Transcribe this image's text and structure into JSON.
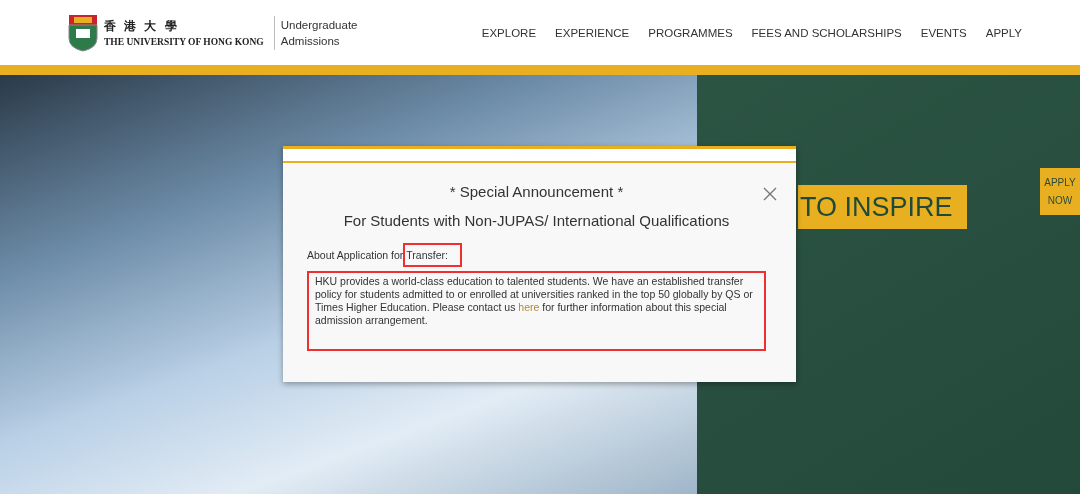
{
  "header": {
    "logo_chinese": "香 港 大 學",
    "logo_english": "THE UNIVERSITY OF HONG KONG",
    "site_title_lines": [
      "Undergraduate",
      "Admissions"
    ],
    "nav": [
      {
        "label": "EXPLORE"
      },
      {
        "label": "EXPERIENCE"
      },
      {
        "label": "PROGRAMMES"
      },
      {
        "label": "FEES AND SCHOLARSHIPS"
      },
      {
        "label": "EVENTS"
      },
      {
        "label": "APPLY"
      }
    ]
  },
  "hero": {
    "banner": "TO INSPIRE",
    "apply_tab_lines": [
      "APPLY",
      "NOW"
    ]
  },
  "modal": {
    "title": "* Special Announcement *",
    "subtitle": "For Students with Non-JUPAS/ International Qualifications",
    "section_label": "About Application for",
    "section_topic": {
      "text": "Transfer:",
      "highlighted": true
    },
    "body": {
      "highlighted": true,
      "before_link": "HKU provides a world-class education to talented students. We have an established transfer policy for students admitted to or enrolled at universities ranked in the top 50 globally by QS or Times Higher Education. Please contact us",
      "link": "here",
      "after_link": "for further information about this special admission arrangement."
    }
  }
}
